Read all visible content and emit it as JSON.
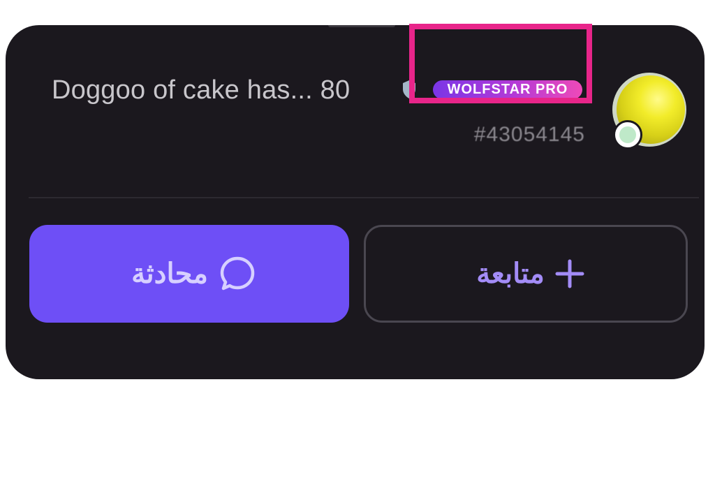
{
  "profile": {
    "username": "Doggoo of cake has... 80",
    "badge": "WOLFSTAR PRO",
    "user_id": "#43054145"
  },
  "actions": {
    "chat_label": "محادثة",
    "follow_label": "متابعة"
  },
  "icons": {
    "chat": "chat-bubble-icon",
    "follow": "plus-icon",
    "level": "shield-icon"
  },
  "colors": {
    "card_background": "#1b181e",
    "chat_button": "#6e4ff6",
    "highlight": "#e8258a",
    "badge_gradient_start": "#7a36e6",
    "badge_gradient_end": "#ee4ab8"
  }
}
